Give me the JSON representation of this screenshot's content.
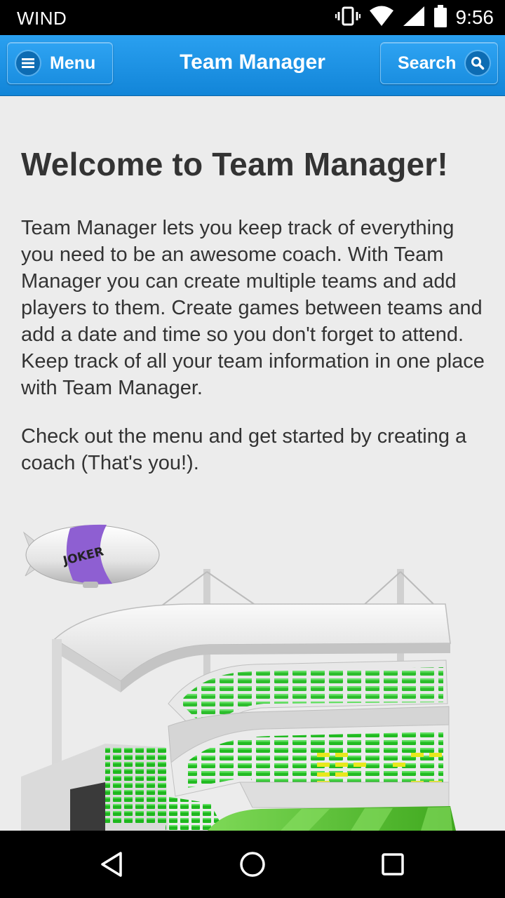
{
  "status_bar": {
    "carrier": "WIND",
    "time": "9:56",
    "icons": [
      "vibrate-icon",
      "wifi-icon",
      "signal-icon",
      "battery-icon"
    ]
  },
  "header": {
    "menu_label": "Menu",
    "title": "Team Manager",
    "search_label": "Search"
  },
  "content": {
    "heading": "Welcome to Team Manager!",
    "paragraph1": "Team Manager lets you keep track of everything you need to be an awesome coach. With Team Manager you can create multiple teams and add players to them. Create games between teams and add a date and time so you don't forget to attend. Keep track of all your team information in one place with Team Manager.",
    "paragraph2": "Check out the menu and get started by creating a coach (That's you!)."
  },
  "illustration": {
    "blimp_text": "JOKER"
  },
  "nav_bar": {
    "icons": [
      "back-icon",
      "home-icon",
      "recents-icon"
    ]
  },
  "colors": {
    "header": "#1a8ee0",
    "background": "#ececec",
    "text": "#333333",
    "seats": "#22bb22"
  }
}
